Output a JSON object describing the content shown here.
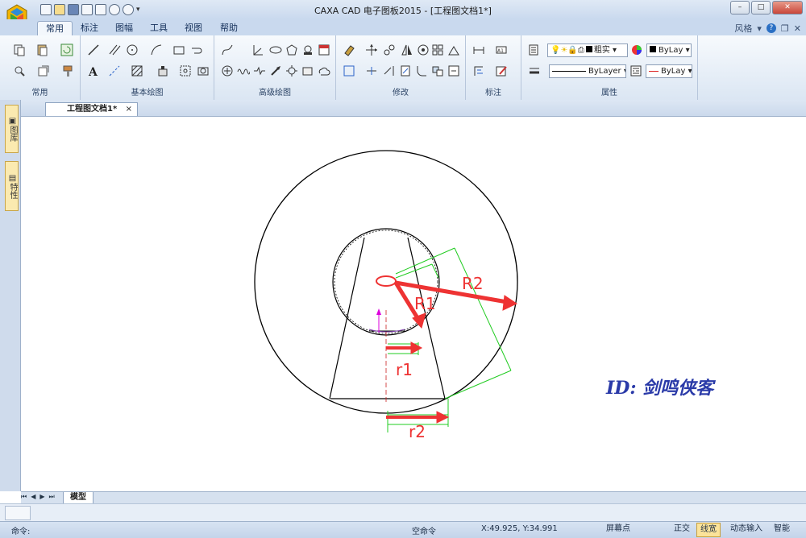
{
  "window": {
    "title": "CAXA CAD 电子图板2015 - [工程图文档1*]",
    "qat_icons": [
      "new-icon",
      "open-icon",
      "save-icon",
      "print-preview-icon",
      "print-icon",
      "undo-icon",
      "redo-icon",
      "customize-icon"
    ]
  },
  "ribbon_tabs": [
    "常用",
    "标注",
    "图幅",
    "工具",
    "视图",
    "帮助"
  ],
  "active_tab": "常用",
  "style_menu": {
    "label": "风格",
    "help": "?"
  },
  "groups": {
    "common": "常用",
    "basic_draw": "基本绘图",
    "advanced_draw": "高级绘图",
    "modify": "修改",
    "annotate": "标注",
    "properties": "属性"
  },
  "properties": {
    "layer_combo": "粗实",
    "color_combo": "ByLay",
    "linetype_combo": "ByLayer",
    "linetype_combo2": "ByLay"
  },
  "document": {
    "tab": "工程图文档1*",
    "close": "×"
  },
  "sidebar": {
    "tab1": "图库",
    "tab2": "特性"
  },
  "drawing": {
    "labels": {
      "R1": "R1",
      "R2": "R2",
      "r1": "r1",
      "r2": "r2"
    },
    "watermark": "ID: 剑鸣侠客",
    "accent_red": "#ee3333",
    "dim_green": "#22cc22"
  },
  "layout": {
    "tab": "模型",
    "nav": [
      "⏮",
      "◀",
      "▶",
      "⏭"
    ]
  },
  "command": {
    "label": "命令:",
    "state": "空命令"
  },
  "status": {
    "coords": "X:49.925, Y:34.991",
    "snap": "屏幕点",
    "ortho": "正交",
    "linewidth": "线宽",
    "dynamic_input": "动态输入",
    "smart": "智能"
  },
  "colors": {
    "ribbon_bg": "#dbe6f3",
    "status_on": "#fbe39a"
  }
}
